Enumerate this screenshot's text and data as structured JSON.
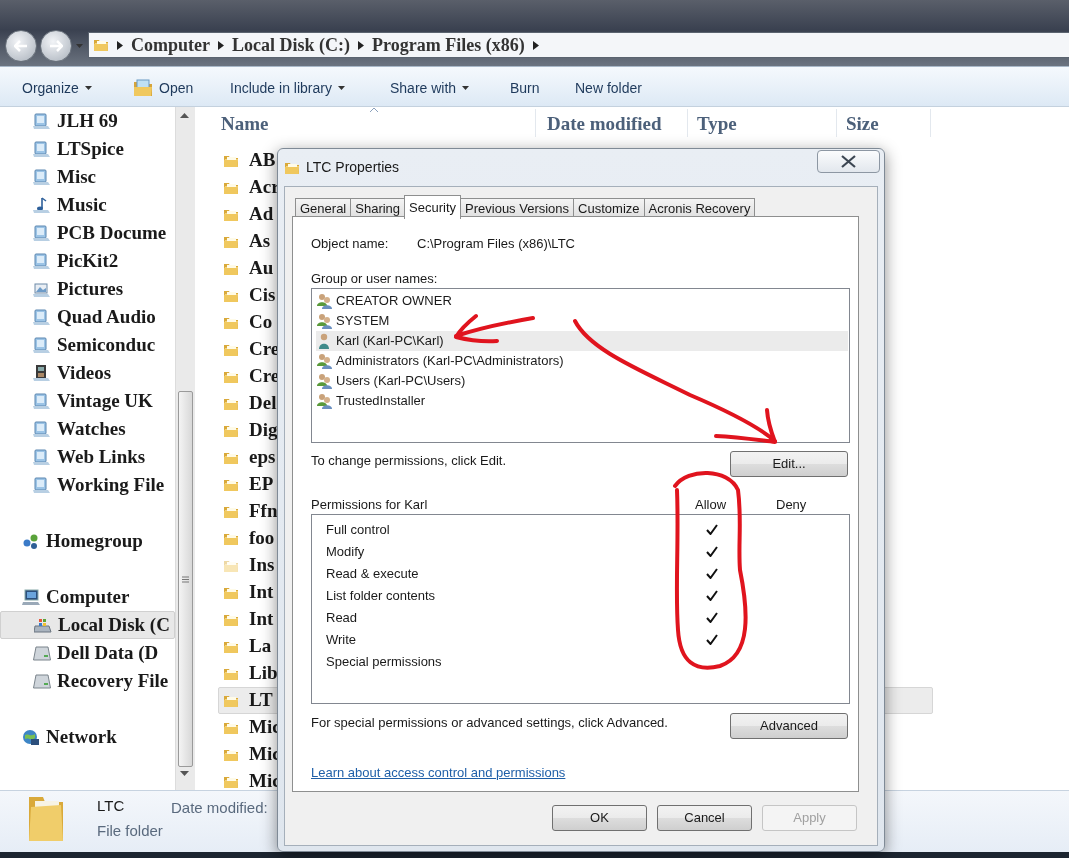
{
  "address": {
    "segments": [
      "Computer",
      "Local Disk (C:)",
      "Program Files (x86)"
    ]
  },
  "toolbar": [
    {
      "label": "Organize",
      "kind": "menu"
    },
    {
      "label": "Open",
      "kind": "icon"
    },
    {
      "label": "Include in library",
      "kind": "menu"
    },
    {
      "label": "Share with",
      "kind": "menu"
    },
    {
      "label": "Burn",
      "kind": "plain"
    },
    {
      "label": "New folder",
      "kind": "plain"
    }
  ],
  "nav": [
    {
      "children": [
        {
          "label": "JLH 69",
          "kind": "library",
          "selected": false
        },
        {
          "label": "LTSpice",
          "kind": "library",
          "selected": false
        },
        {
          "label": "Misc",
          "kind": "library",
          "selected": false
        },
        {
          "label": "Music",
          "kind": "music",
          "selected": false
        },
        {
          "label": "PCB Docume",
          "kind": "library",
          "selected": false
        },
        {
          "label": "PicKit2",
          "kind": "library",
          "selected": false
        },
        {
          "label": "Pictures",
          "kind": "pictures",
          "selected": false
        },
        {
          "label": "Quad Audio",
          "kind": "library",
          "selected": false
        },
        {
          "label": "Semiconduc",
          "kind": "library",
          "selected": false
        },
        {
          "label": "Videos",
          "kind": "videos",
          "selected": false
        },
        {
          "label": "Vintage UK",
          "kind": "library",
          "selected": false
        },
        {
          "label": "Watches",
          "kind": "library",
          "selected": false
        },
        {
          "label": "Web Links",
          "kind": "library",
          "selected": false
        },
        {
          "label": "Working File",
          "kind": "library",
          "selected": false
        }
      ]
    },
    {
      "label": "Homegroup",
      "kind": "homegroup",
      "selected": false
    },
    {
      "label": "Computer",
      "kind": "computer",
      "selected": false,
      "children": [
        {
          "label": "Local Disk (C",
          "kind": "system-disk",
          "selected": true
        },
        {
          "label": "Dell Data (D",
          "kind": "drive",
          "selected": false
        },
        {
          "label": "Recovery File",
          "kind": "drive",
          "selected": false
        }
      ]
    },
    {
      "label": "Network",
      "kind": "network",
      "selected": false
    }
  ],
  "columns": [
    "Name",
    "Date modified",
    "Type",
    "Size"
  ],
  "files": [
    {
      "name": "AB",
      "hidden": false,
      "selected": false
    },
    {
      "name": "Acr",
      "hidden": false,
      "selected": false
    },
    {
      "name": "Ad",
      "hidden": false,
      "selected": false
    },
    {
      "name": "As",
      "hidden": false,
      "selected": false
    },
    {
      "name": "Au",
      "hidden": false,
      "selected": false
    },
    {
      "name": "Cis",
      "hidden": false,
      "selected": false
    },
    {
      "name": "Co",
      "hidden": false,
      "selected": false
    },
    {
      "name": "Cre",
      "hidden": false,
      "selected": false
    },
    {
      "name": "Cre",
      "hidden": false,
      "selected": false
    },
    {
      "name": "Del",
      "hidden": false,
      "selected": false
    },
    {
      "name": "Dig",
      "hidden": false,
      "selected": false
    },
    {
      "name": "eps",
      "hidden": false,
      "selected": false
    },
    {
      "name": "EP",
      "hidden": false,
      "selected": false
    },
    {
      "name": "Ffn",
      "hidden": false,
      "selected": false
    },
    {
      "name": "foo",
      "hidden": false,
      "selected": false
    },
    {
      "name": "Ins",
      "hidden": true,
      "selected": false
    },
    {
      "name": "Int",
      "hidden": false,
      "selected": false
    },
    {
      "name": "Int",
      "hidden": false,
      "selected": false
    },
    {
      "name": "La",
      "hidden": false,
      "selected": false
    },
    {
      "name": "Lib",
      "hidden": false,
      "selected": false
    },
    {
      "name": "LT",
      "hidden": false,
      "selected": true
    },
    {
      "name": "Mic",
      "hidden": false,
      "selected": false
    },
    {
      "name": "Mic",
      "hidden": false,
      "selected": false
    },
    {
      "name": "Mic",
      "hidden": false,
      "selected": false
    }
  ],
  "details": {
    "name": "LTC",
    "type": "File folder",
    "date_label": "Date modified:"
  },
  "dialog": {
    "title": "LTC Properties",
    "tabs": [
      {
        "label": "General",
        "selected": false
      },
      {
        "label": "Sharing",
        "selected": false
      },
      {
        "label": "Security",
        "selected": true
      },
      {
        "label": "Previous Versions",
        "selected": false
      },
      {
        "label": "Customize",
        "selected": false
      },
      {
        "label": "Acronis Recovery",
        "selected": false
      }
    ],
    "object_label": "Object name:",
    "object_value": "C:\\Program Files (x86)\\LTC",
    "users_label": "Group or user names:",
    "users": [
      {
        "name": "CREATOR OWNER",
        "kind": "group",
        "selected": false
      },
      {
        "name": "SYSTEM",
        "kind": "group",
        "selected": false
      },
      {
        "name": "Karl (Karl-PC\\Karl)",
        "kind": "user",
        "selected": true
      },
      {
        "name": "Administrators (Karl-PC\\Administrators)",
        "kind": "group",
        "selected": false
      },
      {
        "name": "Users (Karl-PC\\Users)",
        "kind": "group",
        "selected": false
      },
      {
        "name": "TrustedInstaller",
        "kind": "group",
        "selected": false
      }
    ],
    "change_hint": "To change permissions, click Edit.",
    "edit_button": "Edit...",
    "permissions_label": "Permissions for Karl",
    "allow_label": "Allow",
    "deny_label": "Deny",
    "permissions": [
      {
        "name": "Full control",
        "allow": true,
        "deny": false
      },
      {
        "name": "Modify",
        "allow": true,
        "deny": false
      },
      {
        "name": "Read & execute",
        "allow": true,
        "deny": false
      },
      {
        "name": "List folder contents",
        "allow": true,
        "deny": false
      },
      {
        "name": "Read",
        "allow": true,
        "deny": false
      },
      {
        "name": "Write",
        "allow": true,
        "deny": false
      },
      {
        "name": "Special permissions",
        "allow": false,
        "deny": false
      }
    ],
    "advanced_hint": "For special permissions or advanced settings, click Advanced.",
    "advanced_button": "Advanced",
    "link": "Learn about access control and permissions",
    "buttons": [
      {
        "label": "OK",
        "disabled": false
      },
      {
        "label": "Cancel",
        "disabled": false
      },
      {
        "label": "Apply",
        "disabled": true
      }
    ]
  },
  "annotations": [
    {
      "kind": "arrow"
    },
    {
      "kind": "curved-arrow"
    },
    {
      "kind": "loop"
    }
  ]
}
